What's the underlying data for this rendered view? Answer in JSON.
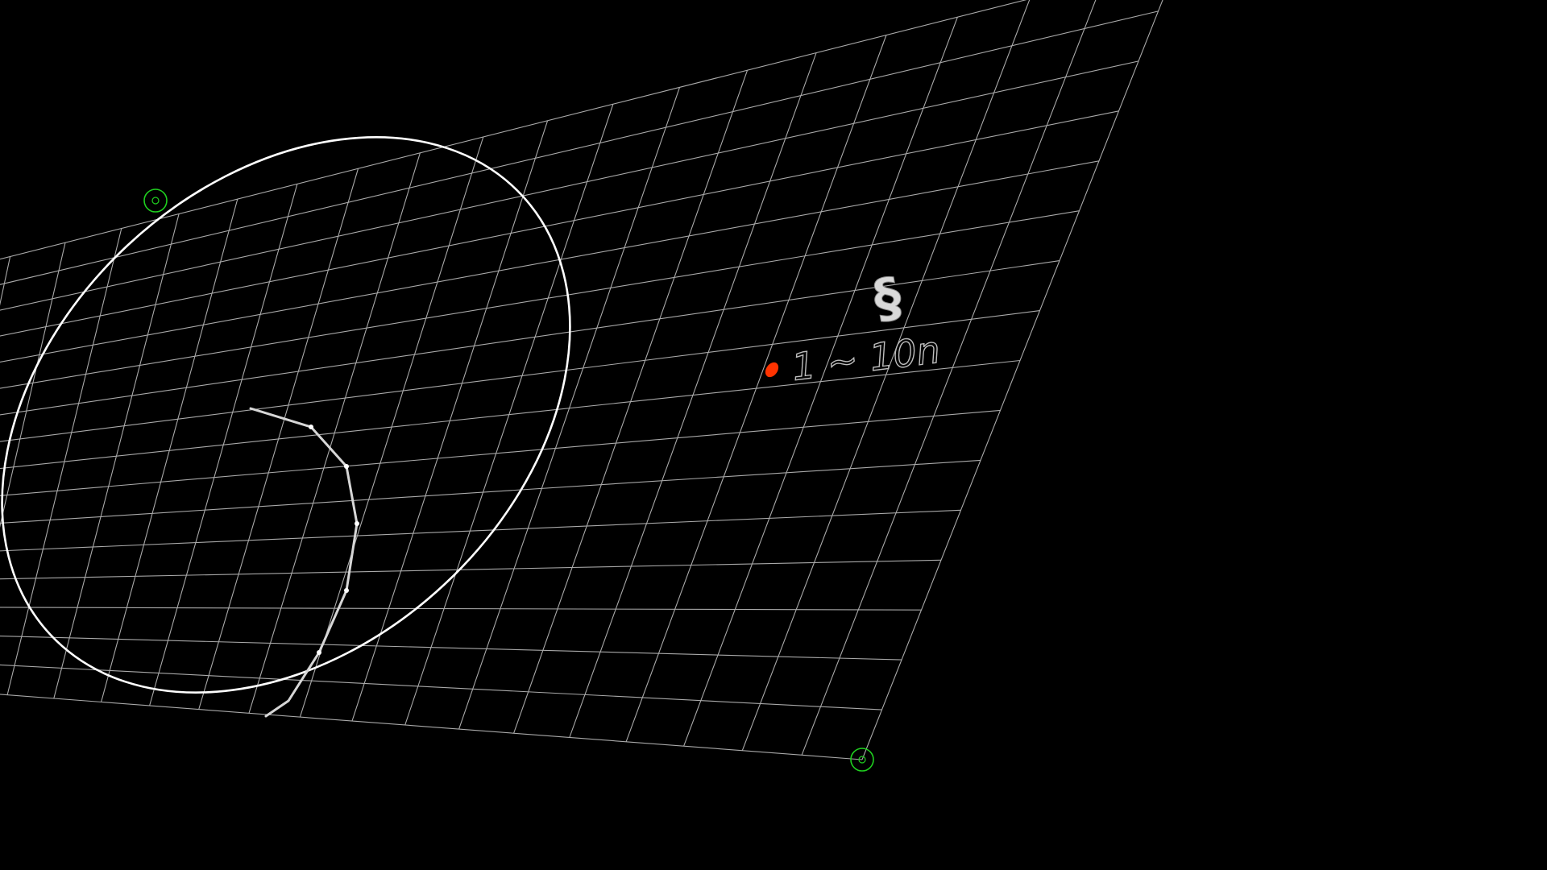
{
  "canvas": {
    "background": "#000000",
    "grid_color": "#a9a9a9",
    "ellipse_color": "#ffffff",
    "polyline_color": "#d6d6d6",
    "handle_color": "#1fcf1f",
    "marker_color": "#ff3300"
  },
  "grid": {
    "columns": 20,
    "rows": 16
  },
  "symbol": {
    "text": "§",
    "icon": "section-sign-icon"
  },
  "annotation": {
    "label": "1 ~ 10n",
    "marker_icon": "red-dot-icon"
  },
  "handles": [
    {
      "icon": "target-handle-icon"
    },
    {
      "icon": "target-handle-icon"
    }
  ]
}
